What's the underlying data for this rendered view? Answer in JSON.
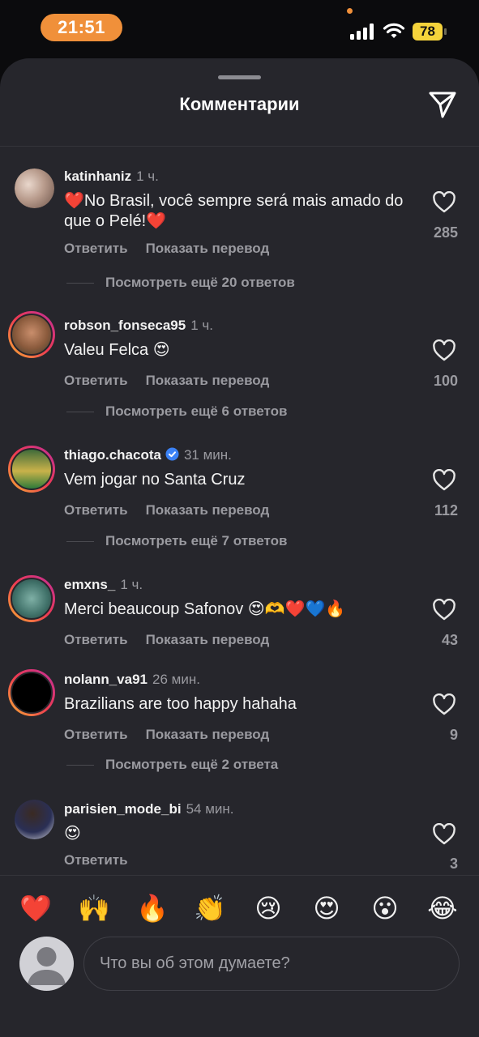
{
  "status_bar": {
    "time": "21:51",
    "battery": "78"
  },
  "sheet": {
    "title": "Комментарии"
  },
  "labels": {
    "reply": "Ответить",
    "translate": "Показать перевод"
  },
  "comments": [
    {
      "username": "katinhaniz",
      "time": "1 ч.",
      "text": "❤️No Brasil, você sempre será mais amado do que o Pelé!❤️",
      "likes": "285",
      "replies": "Посмотреть ещё 20 ответов",
      "verified": false
    },
    {
      "username": "robson_fonseca95",
      "time": "1 ч.",
      "text": "Valeu Felca 😍",
      "likes": "100",
      "replies": "Посмотреть ещё 6 ответов",
      "verified": false
    },
    {
      "username": "thiago.chacota",
      "time": "31 мин.",
      "text": "Vem jogar no Santa Cruz",
      "likes": "112",
      "replies": "Посмотреть ещё 7 ответов",
      "verified": true
    },
    {
      "username": "emxns_",
      "time": "1 ч.",
      "text": "Merci beaucoup Safonov 😍🫶❤️💙🔥",
      "likes": "43",
      "replies": "",
      "verified": false
    },
    {
      "username": "nolann_va91",
      "time": "26 мин.",
      "text": "Brazilians are too happy hahaha",
      "likes": "9",
      "replies": "Посмотреть ещё 2 ответа",
      "verified": false
    },
    {
      "username": "parisien_mode_bi",
      "time": "54 мин.",
      "text": "😍",
      "likes": "3",
      "replies": "",
      "verified": false
    }
  ],
  "emoji_bar": [
    "❤️",
    "🙌",
    "🔥",
    "👏",
    "😢",
    "😍",
    "😮",
    "😂"
  ],
  "composer": {
    "placeholder": "Что вы об этом думаете?"
  },
  "icons": {
    "share": "paper-plane-icon",
    "like": "heart-outline-icon"
  },
  "colors": {
    "accent": "#f0903a",
    "battery": "#f5d33b",
    "sheet_bg": "#26262c",
    "verified": "#3b82f6"
  }
}
